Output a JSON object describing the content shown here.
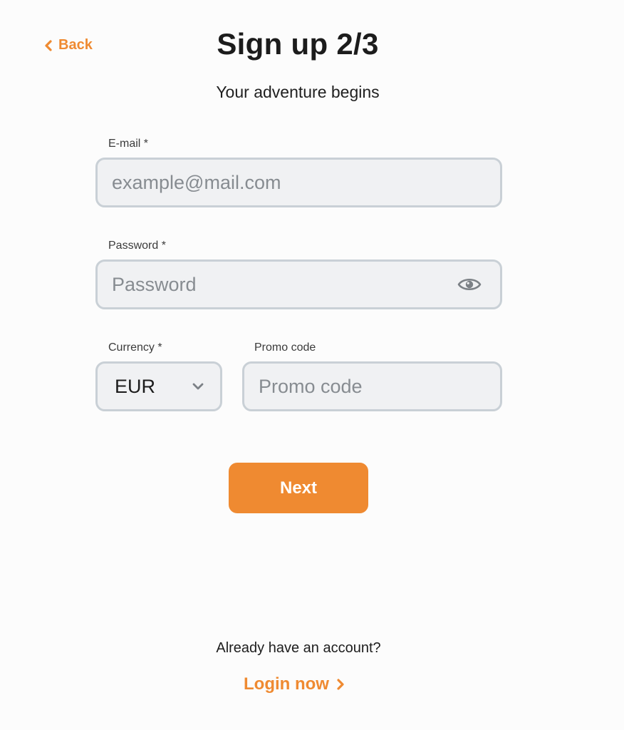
{
  "header": {
    "back_label": "Back",
    "title": "Sign up 2/3",
    "subtitle": "Your adventure begins"
  },
  "form": {
    "email": {
      "label": "E-mail *",
      "placeholder": "example@mail.com",
      "value": ""
    },
    "password": {
      "label": "Password *",
      "placeholder": "Password",
      "value": "",
      "toggle_icon": "eye-icon"
    },
    "currency": {
      "label": "Currency *",
      "selected": "EUR",
      "dropdown_icon": "chevron-down-icon"
    },
    "promo": {
      "label": "Promo code",
      "placeholder": "Promo code",
      "value": ""
    },
    "next_label": "Next"
  },
  "footer": {
    "account_prompt": "Already have an account?",
    "login_label": "Login now"
  },
  "colors": {
    "accent": "#ef8a31",
    "field_bg": "#f0f1f3",
    "field_border": "#c9d0d6",
    "text": "#1b1b1b"
  }
}
